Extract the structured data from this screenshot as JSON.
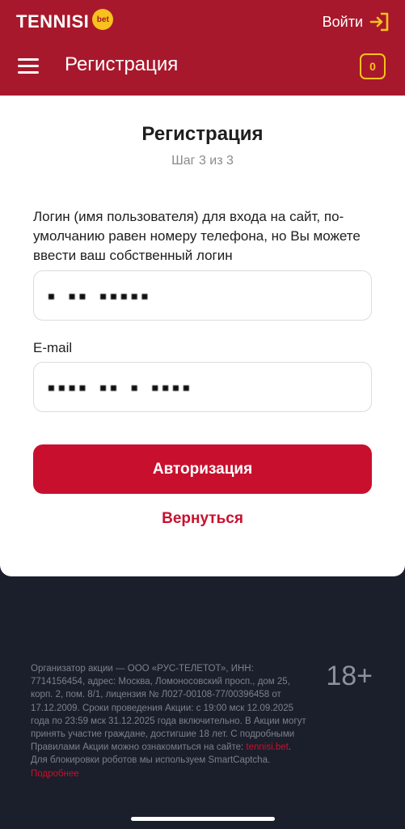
{
  "topbar": {
    "logo_text": "TENNISI",
    "logo_badge": "bet",
    "login_label": "Войти",
    "title": "Регистрация",
    "coupon_count": "0"
  },
  "card": {
    "title": "Регистрация",
    "step": "Шаг 3 из 3",
    "login_label": "Логин (имя пользователя) для входа на сайт, по-умолчанию равен номеру телефона, но Вы можете ввести ваш собственный логин",
    "login_value": "▪ ▪▪ ▪▪▪▪▪",
    "email_label": "E-mail",
    "email_value": "▪▪▪▪ ▪▪ ▪ ▪▪▪▪",
    "auth_button": "Авторизация",
    "back_link": "Вернуться"
  },
  "footer": {
    "text_part1": "Организатор акции — ООО «РУС-ТЕЛЕТОТ», ИНН: 7714156454, адрес: Москва, Ломоносовский просп., дом 25, корп. 2, пом. 8/1, лицензия № Л027-00108-77/00396458 от 17.12.2009. Сроки проведения Акции: с 19:00 мск 12.09.2025 года по 23:59 мск 31.12.2025 года включительно. В Акции могут принять участие граждане, достигшие 18 лет. С подробными Правилами Акции можно ознакомиться на сайте: ",
    "site_link": "tennisi.bet",
    "text_part2": ". Для блокировки роботов мы используем SmartCaptcha.",
    "more_link": "Подробнее",
    "age": "18+"
  },
  "colors": {
    "brand_red": "#a8182c",
    "accent_red": "#c8102e",
    "brand_yellow": "#f6c21b",
    "footer_bg": "#1b1e2b"
  },
  "icons": [
    "menu-icon",
    "login-arrow-icon",
    "coupon-icon"
  ]
}
